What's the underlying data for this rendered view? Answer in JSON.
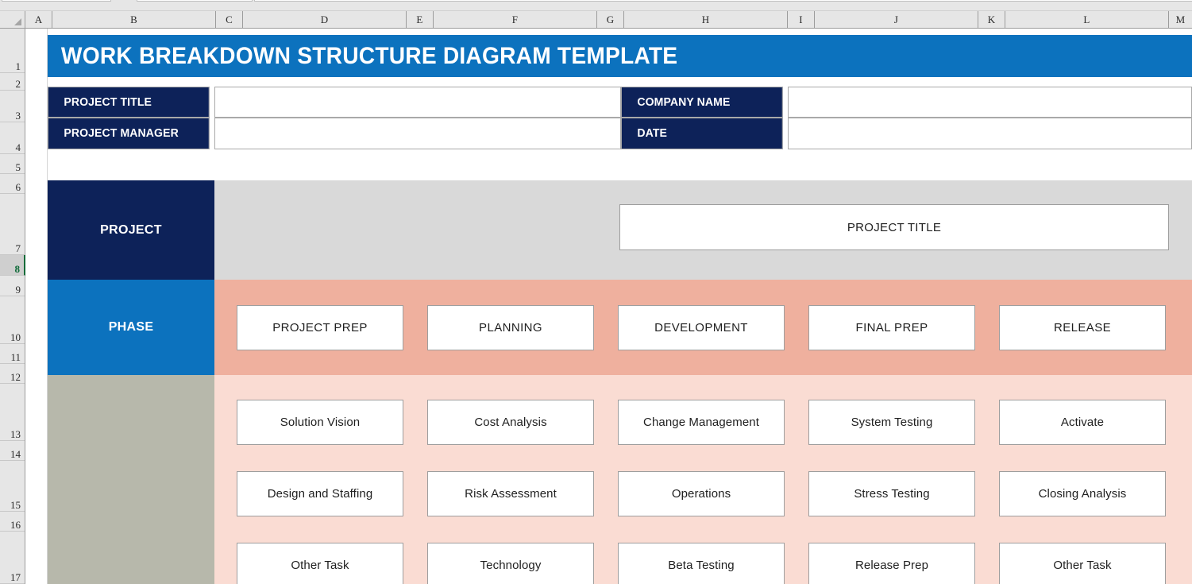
{
  "spreadsheet": {
    "columns": [
      "A",
      "B",
      "C",
      "D",
      "E",
      "F",
      "G",
      "H",
      "I",
      "J",
      "K",
      "L",
      "M"
    ],
    "rows": [
      "1",
      "2",
      "3",
      "4",
      "5",
      "6",
      "7",
      "8",
      "9",
      "10",
      "11",
      "12",
      "13",
      "14",
      "15",
      "16",
      "17"
    ],
    "selected_row": "8"
  },
  "title": {
    "text": "WORK BREAKDOWN STRUCTURE DIAGRAM TEMPLATE",
    "background_color": "#0C72BE",
    "text_color": "#FFFFFF"
  },
  "info_fields": [
    {
      "label": "PROJECT TITLE",
      "value": ""
    },
    {
      "label": "PROJECT MANAGER",
      "value": ""
    },
    {
      "label": "COMPANY NAME",
      "value": ""
    },
    {
      "label": "DATE",
      "value": ""
    }
  ],
  "project_row": {
    "label": "PROJECT",
    "label_color": "#0D2259",
    "band_color": "#D9D9D9",
    "box_text": "PROJECT TITLE"
  },
  "phase_row": {
    "label": "PHASE",
    "label_color": "#0C72BE",
    "band_color": "#EFB09E",
    "phases": [
      "PROJECT PREP",
      "PLANNING",
      "DEVELOPMENT",
      "FINAL PREP",
      "RELEASE"
    ]
  },
  "task_rows": {
    "left_block_color": "#B7B8AB",
    "band_color": "#FADCD3",
    "rows": [
      [
        "Solution Vision",
        "Cost Analysis",
        "Change Management",
        "System Testing",
        "Activate"
      ],
      [
        "Design and Staffing",
        "Risk Assessment",
        "Operations",
        "Stress Testing",
        "Closing Analysis"
      ],
      [
        "Other Task",
        "Technology",
        "Beta Testing",
        "Release Prep",
        "Other Task"
      ]
    ]
  }
}
